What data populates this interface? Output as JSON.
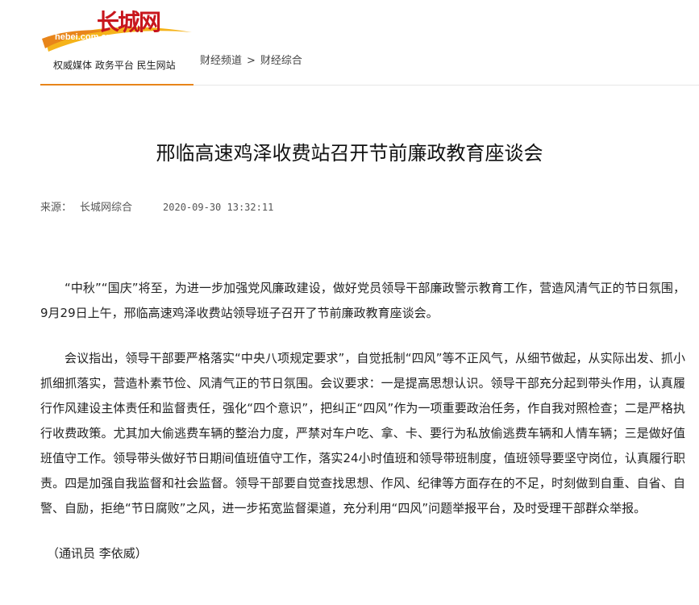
{
  "header": {
    "logo_wordmark": "长城网",
    "logo_domain": "hebei.com.cn",
    "slogan": "权威媒体  政务平台  民生网站",
    "breadcrumb": {
      "channel": "财经频道",
      "separator": ">",
      "section": "财经综合"
    }
  },
  "article": {
    "title": "邢临高速鸡泽收费站召开节前廉政教育座谈会",
    "source_label": "来源：",
    "source_name": "长城网综合",
    "datetime": "2020-09-30 13:32:11",
    "paragraphs": [
      "“中秋”“国庆”将至，为进一步加强党风廉政建设，做好党员领导干部廉政警示教育工作，营造风清气正的节日氛围，9月29日上午，邢临高速鸡泽收费站领导班子召开了节前廉政教育座谈会。",
      "会议指出，领导干部要严格落实“中央八项规定要求”，自觉抵制“四风”等不正风气，从细节做起，从实际出发、抓小抓细抓落实，营造朴素节俭、风清气正的节日氛围。会议要求：一是提高思想认识。领导干部充分起到带头作用，认真履行作风建设主体责任和监督责任，强化“四个意识”，把纠正“四风”作为一项重要政治任务，作自我对照检查；二是严格执行收费政策。尤其加大偷逃费车辆的整治力度，严禁对车户吃、拿、卡、要行为私放偷逃费车辆和人情车辆；三是做好值班值守工作。领导带头做好节日期间值班值守工作，落实24小时值班和领导带班制度，值班领导要坚守岗位，认真履行职责。四是加强自我监督和社会监督。领导干部要自觉查找思想、作风、纪律等方面存在的不足，时刻做到自重、自省、自警、自励，拒绝“节日腐败”之风，进一步拓宽监督渠道，充分利用“四风”问题举报平台，及时受理干部群众举报。"
    ],
    "byline": "（通讯员 李依威）"
  },
  "colors": {
    "brand_red": "#c8161d",
    "accent_orange": "#e8851a",
    "swoosh_yellow": "#f5b31a"
  },
  "icons": [
    "logo-swoosh-icon"
  ]
}
